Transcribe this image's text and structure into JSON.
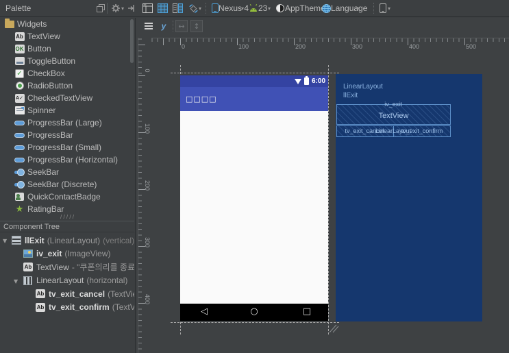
{
  "toolbar": {
    "palette_title": "Palette",
    "device": "Nexus 4",
    "api": "23",
    "theme": "AppTheme",
    "language": "Language"
  },
  "palette": {
    "group": "Widgets",
    "items": [
      "TextView",
      "Button",
      "ToggleButton",
      "CheckBox",
      "RadioButton",
      "CheckedTextView",
      "Spinner",
      "ProgressBar (Large)",
      "ProgressBar",
      "ProgressBar (Small)",
      "ProgressBar (Horizontal)",
      "SeekBar",
      "SeekBar (Discrete)",
      "QuickContactBadge",
      "RatingBar"
    ],
    "icon_badges": {
      "textview": "Ab",
      "button": "OK",
      "checkbox": "✓",
      "checkedtextview": "A✓",
      "star": "★"
    }
  },
  "component_tree": {
    "header": "Component Tree",
    "rows": [
      {
        "label": "llExit",
        "meta": "(LinearLayout)",
        "meta2": "(vertical)"
      },
      {
        "label": "iv_exit",
        "meta": "(ImageView)",
        "meta2": ""
      },
      {
        "label": "TextView",
        "meta": "- \"쿠폰의리를 종료하시",
        "meta2": ""
      },
      {
        "label": "LinearLayout",
        "meta": "(horizontal)",
        "meta2": ""
      },
      {
        "label": "tv_exit_cancel",
        "meta": "(TextView) - \"",
        "meta2": ""
      },
      {
        "label": "tv_exit_confirm",
        "meta": "(TextView) -",
        "meta2": ""
      }
    ],
    "expand_arrow": "▼"
  },
  "design": {
    "ruler_h": [
      "0",
      "100",
      "200",
      "300",
      "400",
      "500"
    ],
    "ruler_v": [
      "0",
      "100",
      "200",
      "300",
      "400"
    ],
    "phone": {
      "time": "6:00",
      "title_glyphs": "□□□□",
      "nav_back": "◁",
      "nav_home": "○",
      "nav_recents": "□"
    },
    "blueprint": {
      "root_type": "LinearLayout",
      "root_id": "llExit",
      "box_label": "iv_exit",
      "box_text": "TextView",
      "cell_left": "tv_exit_cancel",
      "cell_mid": "LinearLayout",
      "cell_right": "tv_exit_confirm"
    },
    "colors": {
      "statusbar": "#3443a2",
      "actionbar": "#4051b5",
      "blueprint_bg": "#15376e",
      "blueprint_line": "#5d90ca"
    }
  }
}
